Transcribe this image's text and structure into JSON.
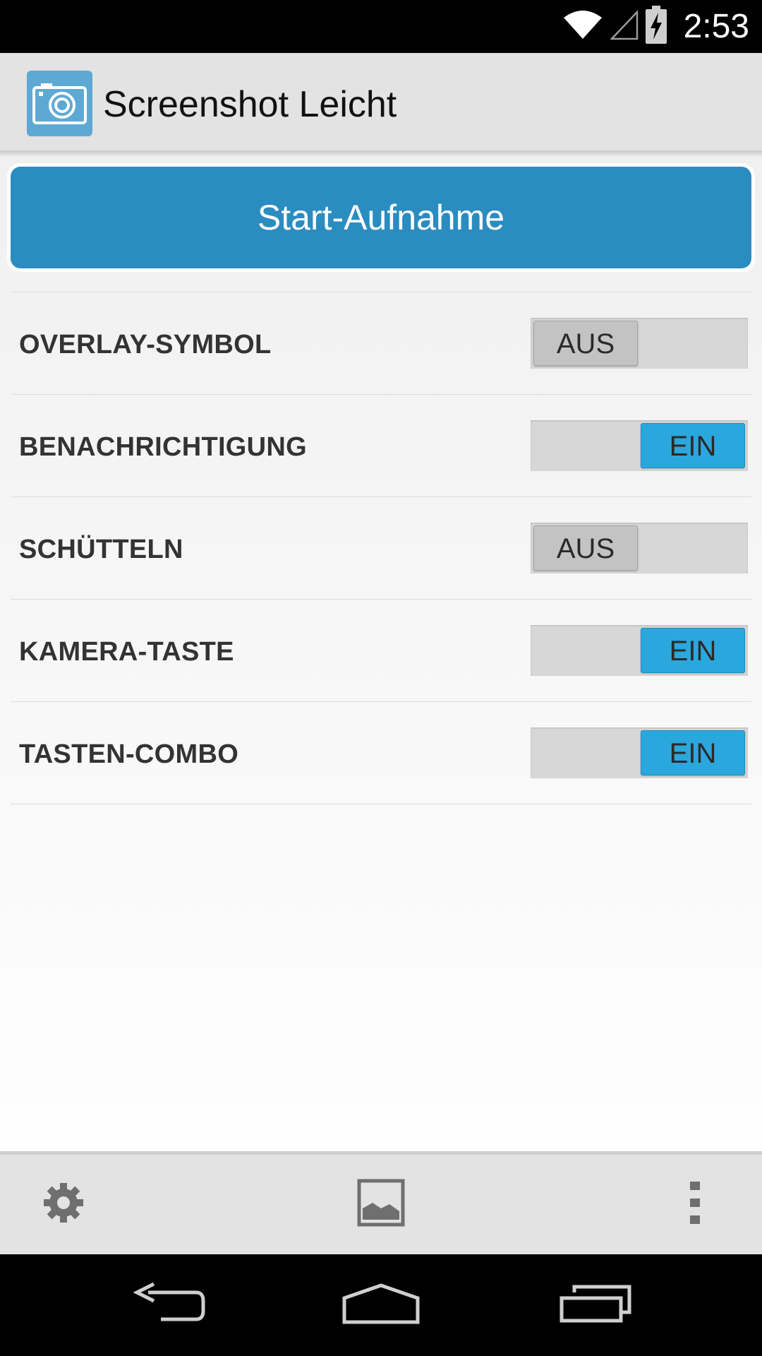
{
  "status_bar": {
    "time": "2:53",
    "icons": [
      "wifi-icon",
      "signal-icon",
      "battery-charging-icon"
    ]
  },
  "app": {
    "title": "Screenshot Leicht",
    "icon": "camera-icon"
  },
  "start_button": {
    "label": "Start-Aufnahme"
  },
  "settings": [
    {
      "label": "OVERLAY-SYMBOL",
      "state": "AUS",
      "on": false
    },
    {
      "label": "BENACHRICHTIGUNG",
      "state": "EIN",
      "on": true
    },
    {
      "label": "SCHÜTTELN",
      "state": "AUS",
      "on": false
    },
    {
      "label": "KAMERA-TASTE",
      "state": "EIN",
      "on": true
    },
    {
      "label": "TASTEN-COMBO",
      "state": "EIN",
      "on": true
    }
  ],
  "bottom_bar": {
    "icons": [
      "gear-icon",
      "gallery-icon",
      "overflow-menu-icon"
    ]
  },
  "nav_bar": {
    "icons": [
      "back-icon",
      "home-icon",
      "recents-icon"
    ]
  },
  "colors": {
    "accent": "#2b8cc0",
    "toggle_on": "#2aa7dc",
    "toggle_off": "#c3c3c3",
    "action_bar": "#e3e3e3"
  }
}
